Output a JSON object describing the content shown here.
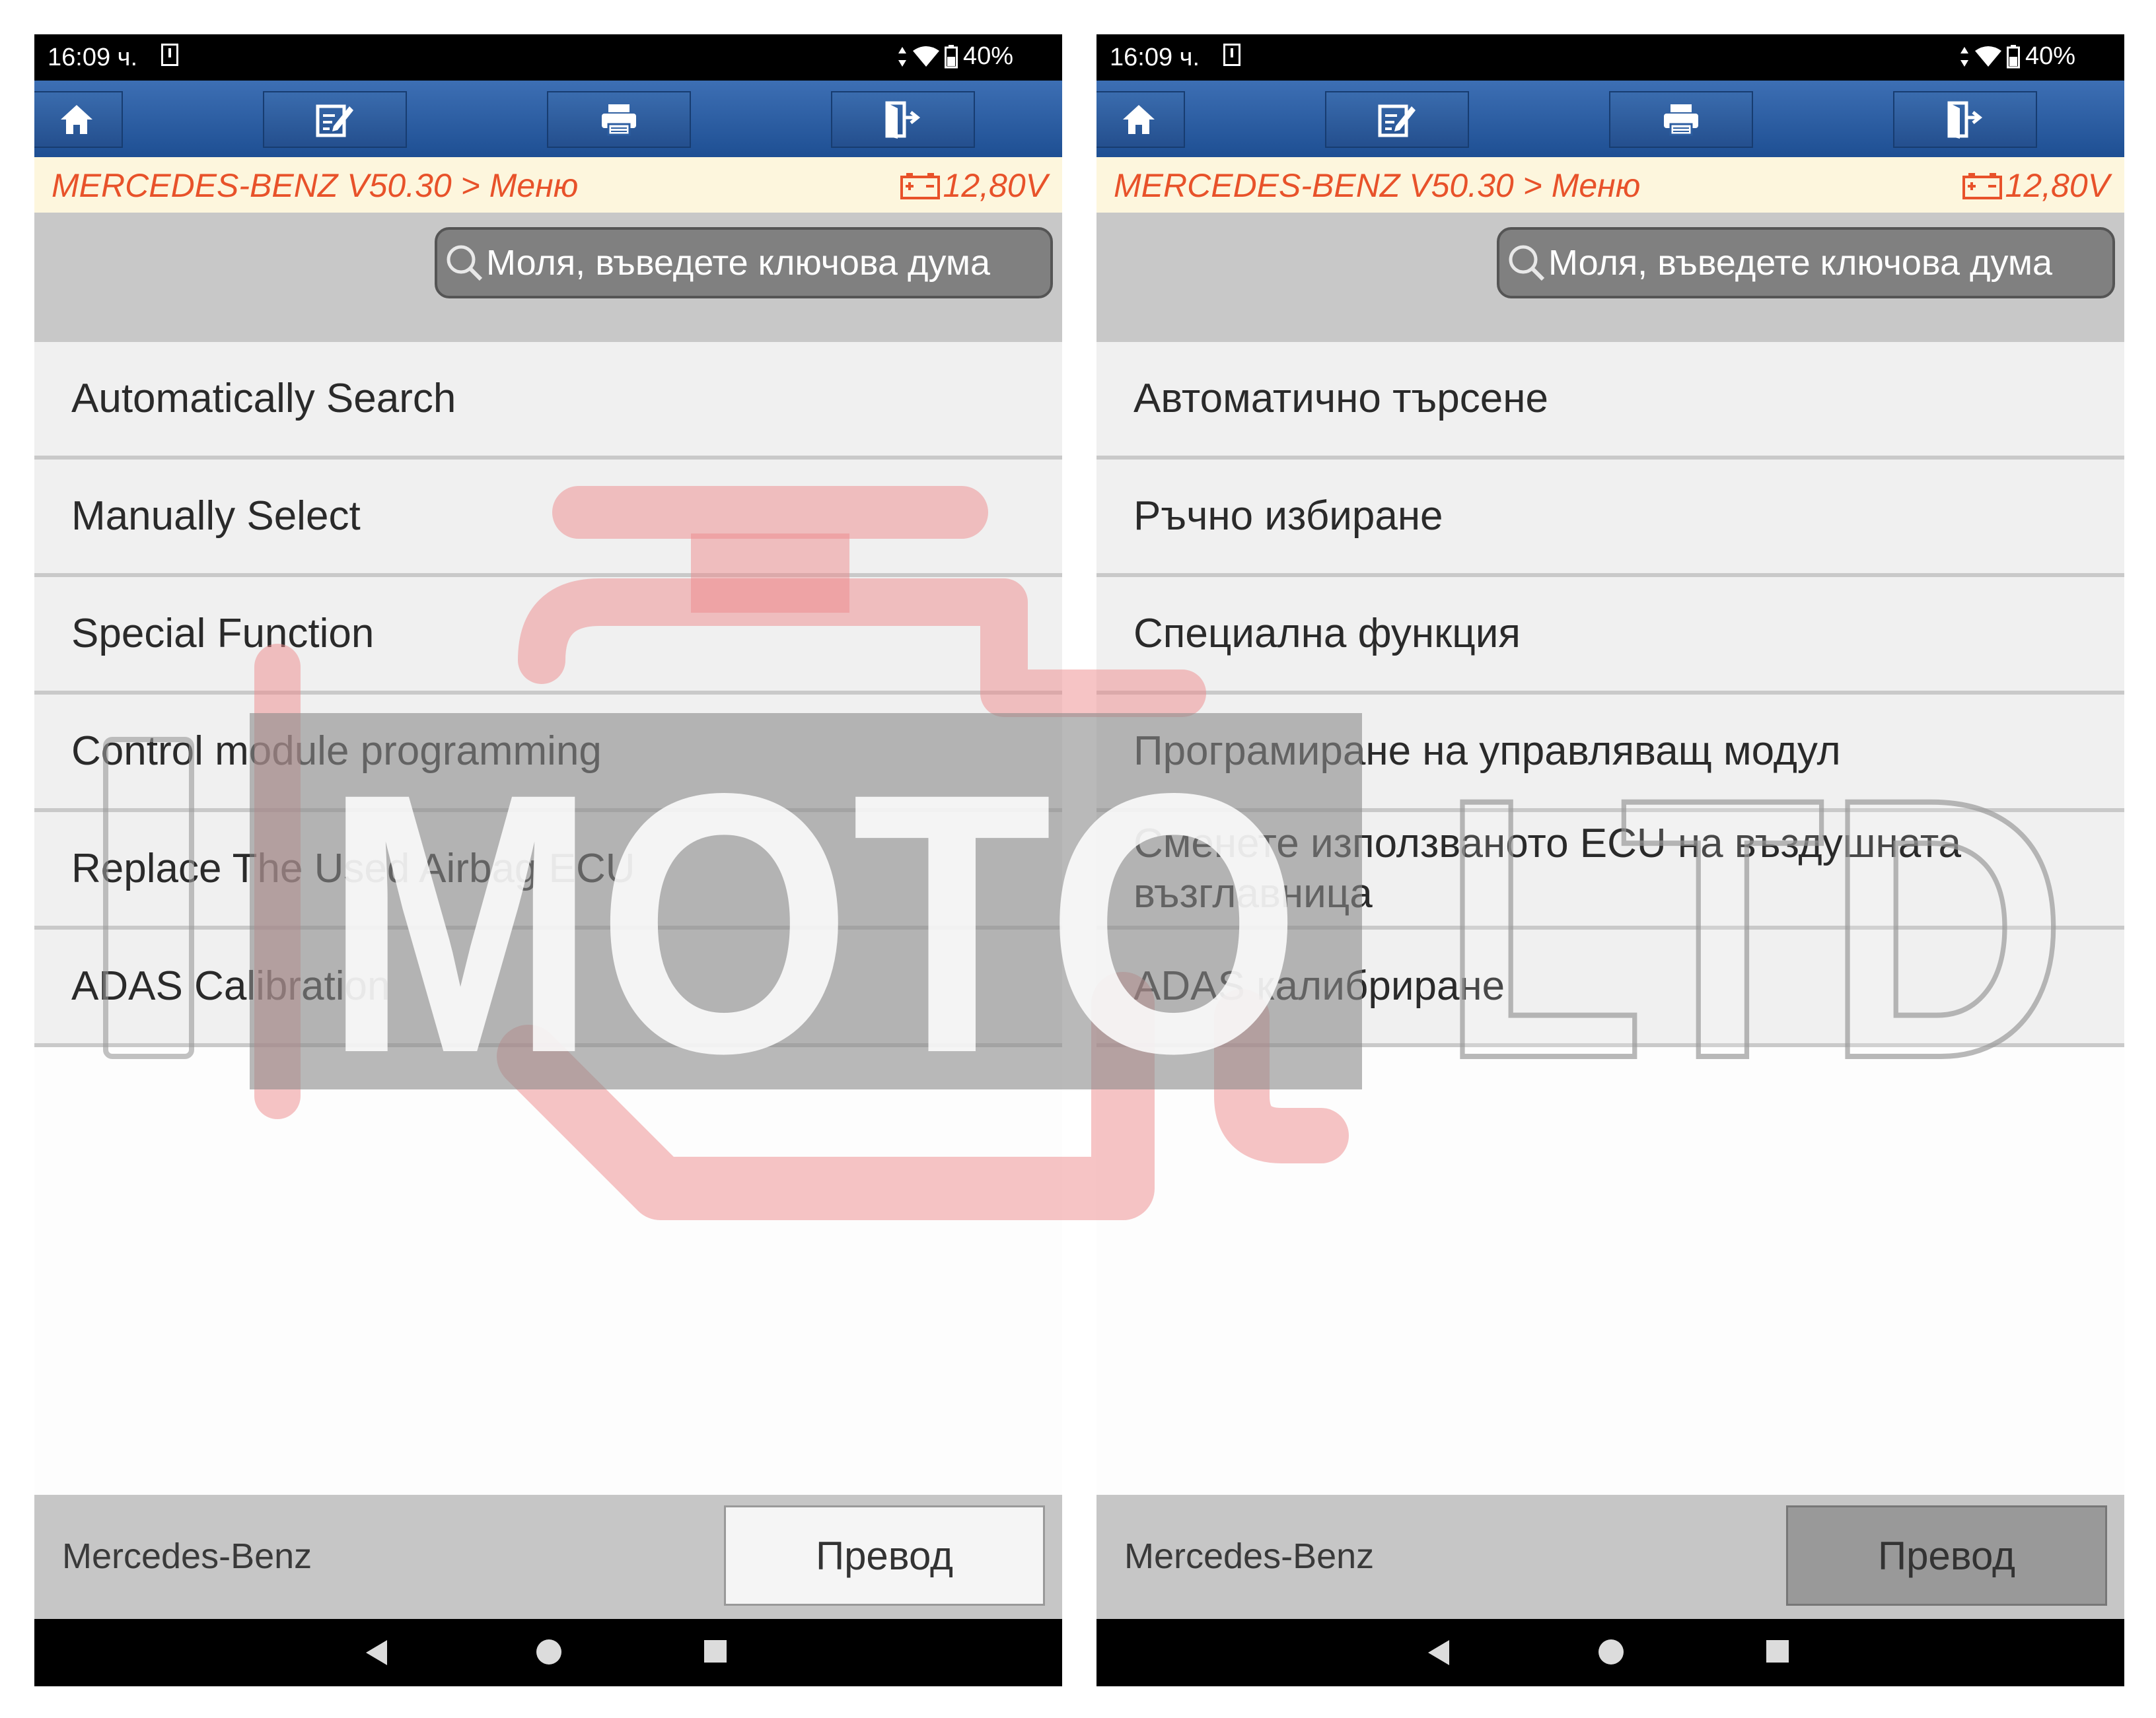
{
  "watermark": {
    "text_a": "MOTO",
    "text_b": "LTD"
  },
  "colors": {
    "toolbar": "#2c5da0",
    "breadcrumb_text": "#e8522a",
    "breadcrumb_bg": "#fdf6dd",
    "menu_bg": "#f0f0f0",
    "status_bg": "#000000"
  },
  "panels": {
    "left": {
      "status": {
        "time": "16:09 ч.",
        "battery": "40%"
      },
      "breadcrumb": {
        "path": "MERCEDES-BENZ V50.30 > Меню",
        "voltage": "12,80V"
      },
      "search": {
        "placeholder": "Моля, въведете ключова дума"
      },
      "menu": [
        "Automatically Search",
        "Manually Select",
        "Special Function",
        "Control module programming",
        "Replace The Used Airbag ECU",
        "ADAS Calibration"
      ],
      "footer": {
        "brand": "Mercedes-Benz",
        "translate": "Превод"
      }
    },
    "right": {
      "status": {
        "time": "16:09 ч.",
        "battery": "40%"
      },
      "breadcrumb": {
        "path": "MERCEDES-BENZ V50.30 > Меню",
        "voltage": "12,80V"
      },
      "search": {
        "placeholder": "Моля, въведете ключова дума"
      },
      "menu": [
        "Автоматично търсене",
        "Ръчно избиране",
        "Специална функция",
        "Програмиране на управляващ модул",
        "Сменете използваното ECU на въздушната възглавница",
        "ADAS калибриране"
      ],
      "footer": {
        "brand": "Mercedes-Benz",
        "translate": "Превод"
      }
    }
  }
}
